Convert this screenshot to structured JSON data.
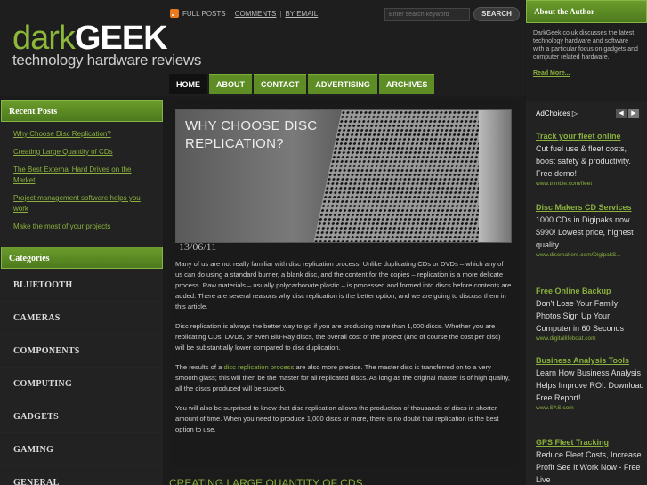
{
  "site": {
    "brand_dark": "dark",
    "brand_geek": "GEEK",
    "tagline": "technology hardware reviews"
  },
  "topbar": {
    "full_posts": "FULL POSTS",
    "comments": "COMMENTS",
    "by_email": "BY EMAIL",
    "sep": "|"
  },
  "search": {
    "placeholder": "Enter search keyword",
    "button": "SEARCH"
  },
  "nav": [
    "HOME",
    "ABOUT",
    "CONTACT",
    "ADVERTISING",
    "ARCHIVES"
  ],
  "recent_posts": {
    "heading": "Recent Posts",
    "items": [
      "Why Choose Disc Replication?",
      "Creating Large Quantity of CDs",
      "The Best External Hard Drives on the Market",
      "Project management software helps you work",
      "Make the most of your projects"
    ]
  },
  "categories": {
    "heading": "Categories",
    "items": [
      "BLUETOOTH",
      "CAMERAS",
      "COMPONENTS",
      "COMPUTING",
      "GADGETS",
      "GAMING",
      "GENERAL"
    ]
  },
  "post": {
    "title": "WHY CHOOSE DISC REPLICATION?",
    "date": "13/06/11",
    "p1": "Many of us are not really familiar with disc replication process. Unlike duplicating CDs or DVDs – which any of us can do using a standard burner, a blank disc, and the content for the copies – replication is a more delicate process. Raw materials – usually polycarbonate plastic – is processed and formed into discs before contents are added. There are several reasons why disc replication is the better option, and we are going to discuss them in this article.",
    "p2": "Disc replication is always the better way to go if you are producing more than 1,000 discs. Whether you are replicating CDs, DVDs, or even Blu-Ray discs, the overall cost of the project (and of course the cost per disc) will be substantially lower compared to disc duplication.",
    "p3_pre": "The results of a ",
    "p3_link": "disc replication process",
    "p3_post": " are also more precise. The master disc is transferred on to a very smooth glass; this will then be the master for all replicated discs. As long as the original master is of high quality, all the discs produced will be superb.",
    "p4": "You will also be surprised to know that disc replication allows the production of thousands of discs in shorter amount of time. When you need to produce 1,000 discs or more, there is no doubt that replication is the best option to use.",
    "next_title": "CREATING LARGE QUANTITY OF CDS"
  },
  "about": {
    "heading": "About the Author",
    "text": "DarkGeek.co.uk discusses the latest technology hardware and software with a particular focus on gadgets and computer related hardware.",
    "read_more": "Read More..."
  },
  "ads": {
    "adchoices": "AdChoices",
    "items": [
      {
        "title": "Track your fleet online",
        "desc": "Cut fuel use & fleet costs, boost safety & productivity. Free demo!",
        "url": "www.trimble.com/fleet"
      },
      {
        "title": "Disc Makers CD Services",
        "desc": "1000 CDs in Digipaks now $990! Lowest price, highest quality.",
        "url": "www.discmakers.com/DigipakS..."
      },
      {
        "title": "Free Online Backup",
        "desc": "Don't Lose Your Family Photos Sign Up Your Computer in 60 Seconds",
        "url": "www.digitallifeboat.com"
      },
      {
        "title": "Business Analysis Tools",
        "desc": "Learn How Business Analysis Helps Improve ROI. Download Free Report!",
        "url": "www.SAS.com"
      },
      {
        "title": "GPS Fleet Tracking",
        "desc": "Reduce Fleet Costs, Increase Profit See It Work Now - Free Live",
        "url": ""
      }
    ]
  },
  "colors": {
    "accent": "#5e8d26",
    "link": "#8ab13d",
    "background": "#1b1b1b"
  }
}
